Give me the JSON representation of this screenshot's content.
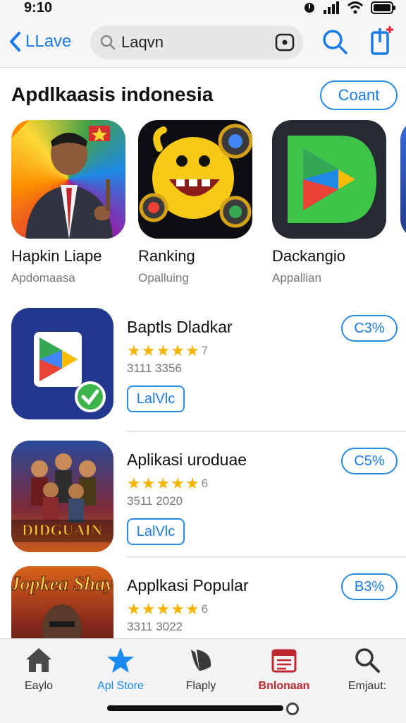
{
  "status": {
    "time": "9:10"
  },
  "nav": {
    "back_label": "LLave",
    "search_value": "Laqvn",
    "accent": "#1a7be8"
  },
  "section": {
    "title": "Apdlkaasis indonesia",
    "count_label": "Coant"
  },
  "featured": [
    {
      "name": "Hapkin Liape",
      "sub": "Apdomaasa",
      "icon": "man-in-suit-thumbnail"
    },
    {
      "name": "Ranking",
      "sub": "Opalluing",
      "icon": "yellow-monster-thumbnail"
    },
    {
      "name": "Dackangio",
      "sub": "Appallian",
      "icon": "play-logo-thumbnail"
    }
  ],
  "apps": [
    {
      "title": "Baptls Dladkar",
      "rating": "7",
      "meta": "3111 3356",
      "get_label": "LalVlc",
      "price": "C3%",
      "icon": "play-logo-checkmark-icon"
    },
    {
      "title": "Aplikasi uroduae",
      "rating": "6",
      "meta": "3511 2020",
      "get_label": "LalVlc",
      "price": "C5%",
      "icon": "game-poster-icon"
    },
    {
      "title": "Applkasi Popular",
      "rating": "6",
      "meta": "3311 3022",
      "get_label": "",
      "price": "B3%",
      "icon": "movie-poster-icon"
    }
  ],
  "tabs": [
    {
      "label": "Eaylo",
      "icon": "home-icon",
      "active": false
    },
    {
      "label": "Apl Store",
      "icon": "star-icon",
      "active": true
    },
    {
      "label": "Flaply",
      "icon": "leaf-icon",
      "active": false
    },
    {
      "label": "Bnlonaan",
      "icon": "calendar-icon",
      "active": false
    },
    {
      "label": "Emjaut:",
      "icon": "search-icon",
      "active": false
    }
  ]
}
